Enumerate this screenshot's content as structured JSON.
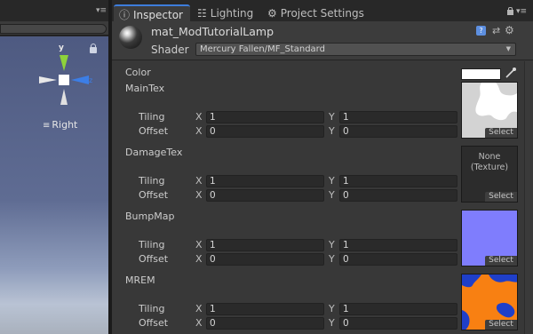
{
  "scene": {
    "orientation_label": "Right",
    "gizmo_axis_label": "y",
    "colors": {
      "sky_top": "#4e5a81",
      "y_axis": "#8ed33a",
      "z_axis": "#3c7ee6"
    }
  },
  "tabs": [
    {
      "label": "Inspector",
      "icon": "info-icon",
      "active": true
    },
    {
      "label": "Lighting",
      "icon": "lighting-icon",
      "active": false
    },
    {
      "label": "Project Settings",
      "icon": "gear-icon",
      "active": false
    }
  ],
  "material": {
    "name": "mat_ModTutorialLamp",
    "shader_label": "Shader",
    "shader_value": "Mercury Fallen/MF_Standard"
  },
  "properties": {
    "color": {
      "label": "Color",
      "value": "#ffffff"
    },
    "tiling_label": "Tiling",
    "offset_label": "Offset",
    "axis_x": "X",
    "axis_y": "Y",
    "select_label": "Select",
    "none_texture_line1": "None",
    "none_texture_line2": "(Texture)",
    "textures": [
      {
        "label": "MainTex",
        "tiling_x": "1",
        "tiling_y": "1",
        "offset_x": "0",
        "offset_y": "0",
        "preview": "grey-white"
      },
      {
        "label": "DamageTex",
        "tiling_x": "1",
        "tiling_y": "1",
        "offset_x": "0",
        "offset_y": "0",
        "preview": "none"
      },
      {
        "label": "BumpMap",
        "tiling_x": "1",
        "tiling_y": "1",
        "offset_x": "0",
        "offset_y": "0",
        "preview": "#7f7dfd"
      },
      {
        "label": "MREM",
        "tiling_x": "1",
        "tiling_y": "1",
        "offset_x": "0",
        "offset_y": "0",
        "preview": "#f88012"
      }
    ]
  }
}
